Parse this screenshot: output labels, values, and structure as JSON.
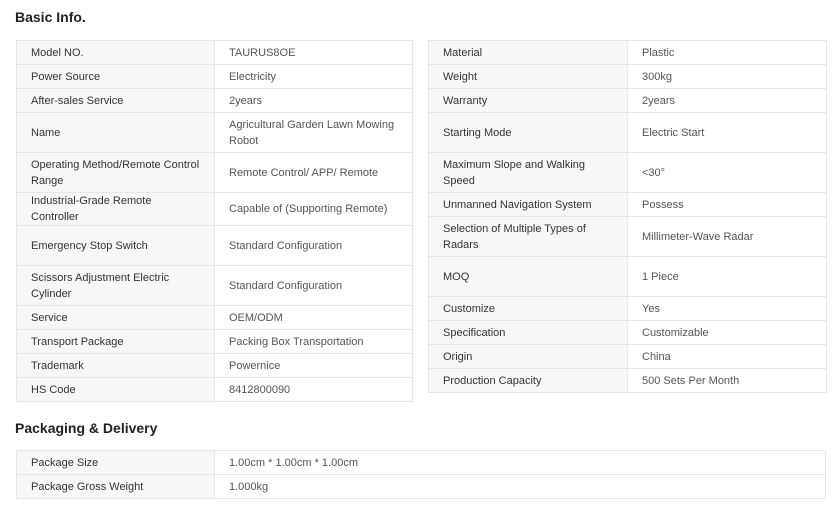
{
  "sections": {
    "basic_title": "Basic Info.",
    "packaging_title": "Packaging & Delivery"
  },
  "basic_left": [
    {
      "label": "Model NO.",
      "value": "TAURUS8OE"
    },
    {
      "label": "Power Source",
      "value": "Electricity"
    },
    {
      "label": "After-sales Service",
      "value": "2years"
    },
    {
      "label": "Name",
      "value": "Agricultural Garden Lawn Mowing Robot"
    },
    {
      "label": "Operating Method/Remote Control Range",
      "value": "Remote Control/ APP/ Remote"
    },
    {
      "label": "Industrial-Grade Remote Controller",
      "value": "Capable of (Supporting Remote)"
    },
    {
      "label": "Emergency Stop Switch",
      "value": "Standard Configuration"
    },
    {
      "label": "Scissors Adjustment Electric Cylinder",
      "value": "Standard Configuration"
    },
    {
      "label": "Service",
      "value": "OEM/ODM"
    },
    {
      "label": "Transport Package",
      "value": "Packing Box Transportation"
    },
    {
      "label": "Trademark",
      "value": "Powernice"
    },
    {
      "label": "HS Code",
      "value": "8412800090"
    }
  ],
  "basic_right": [
    {
      "label": "Material",
      "value": "Plastic"
    },
    {
      "label": "Weight",
      "value": "300kg"
    },
    {
      "label": "Warranty",
      "value": "2years"
    },
    {
      "label": "Starting Mode",
      "value": "Electric Start"
    },
    {
      "label": "Maximum Slope and Walking Speed",
      "value": "<30°"
    },
    {
      "label": "Unmanned Navigation System",
      "value": "Possess"
    },
    {
      "label": "Selection of Multiple Types of Radars",
      "value": "Millimeter-Wave Radar"
    },
    {
      "label": "MOQ",
      "value": "1 Piece"
    },
    {
      "label": "Customize",
      "value": "Yes"
    },
    {
      "label": "Specification",
      "value": "Customizable"
    },
    {
      "label": "Origin",
      "value": "China"
    },
    {
      "label": "Production Capacity",
      "value": "500 Sets Per Month"
    }
  ],
  "packaging": [
    {
      "label": "Package Size",
      "value": "1.00cm * 1.00cm * 1.00cm"
    },
    {
      "label": "Package Gross Weight",
      "value": "1.000kg"
    }
  ]
}
